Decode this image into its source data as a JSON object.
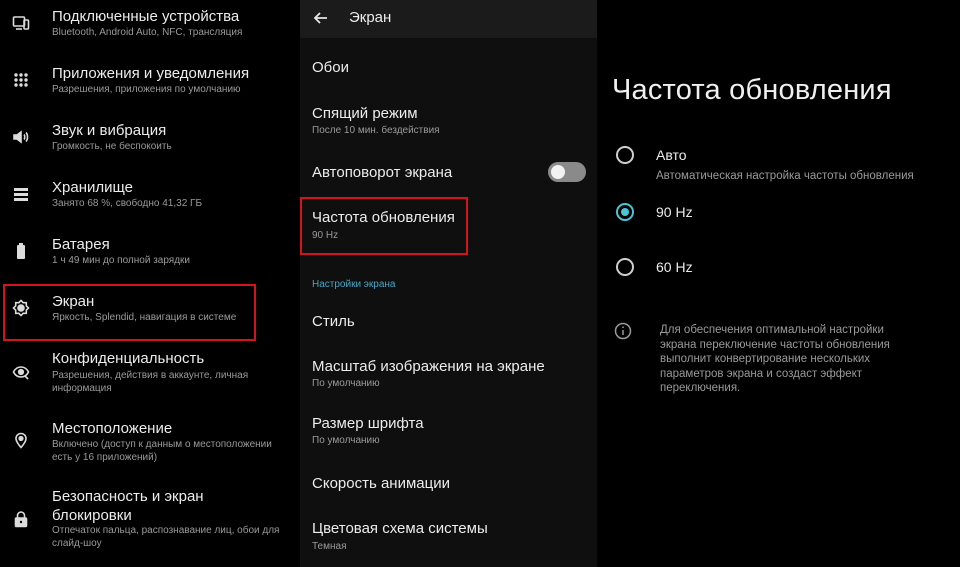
{
  "left_menu": {
    "items": [
      {
        "title": "Подключенные устройства",
        "subtitle": "Bluetooth, Android Auto, NFC, трансляция",
        "icon": "devices-icon"
      },
      {
        "title": "Приложения и уведомления",
        "subtitle": "Разрешения, приложения по умолчанию",
        "icon": "apps-icon"
      },
      {
        "title": "Звук и вибрация",
        "subtitle": "Громкость, не беспокоить",
        "icon": "volume-icon"
      },
      {
        "title": "Хранилище",
        "subtitle": "Занято 68 %, свободно 41,32 ГБ",
        "icon": "storage-icon"
      },
      {
        "title": "Батарея",
        "subtitle": "1 ч 49 мин до полной зарядки",
        "icon": "battery-icon"
      },
      {
        "title": "Экран",
        "subtitle": "Яркость, Splendid, навигация в системе",
        "icon": "display-icon",
        "highlighted": true
      },
      {
        "title": "Конфиденциальность",
        "subtitle": "Разрешения, действия в аккаунте, личная информация",
        "icon": "privacy-eye-icon"
      },
      {
        "title": "Местоположение",
        "subtitle": "Включено (доступ к данным о местоположении есть у 16 приложений)",
        "icon": "location-pin-icon"
      },
      {
        "title": "Безопасность и экран блокировки",
        "subtitle": "Отпечаток пальца, распознавание лиц, обои для слайд-шоу",
        "icon": "lock-icon"
      }
    ]
  },
  "display_screen": {
    "title": "Экран",
    "items": [
      {
        "title": "Обои"
      },
      {
        "title": "Спящий режим",
        "subtitle": "После 10 мин. бездействия"
      },
      {
        "title": "Автоповорот экрана",
        "toggle_on": false
      },
      {
        "title": "Частота обновления",
        "subtitle": "90 Hz",
        "highlighted": true
      },
      {
        "title": "Стиль"
      },
      {
        "title": "Масштаб изображения на экране",
        "subtitle": "По умолчанию"
      },
      {
        "title": "Размер шрифта",
        "subtitle": "По умолчанию"
      },
      {
        "title": "Скорость анимации"
      },
      {
        "title": "Цветовая схема системы",
        "subtitle": "Темная"
      }
    ],
    "section_label": "Настройки экрана"
  },
  "refresh_rate": {
    "title": "Частота обновления",
    "options": [
      {
        "label": "Авто",
        "description": "Автоматическая настройка частоты обновления",
        "selected": false
      },
      {
        "label": "90 Hz",
        "selected": true
      },
      {
        "label": "60 Hz",
        "selected": false
      }
    ],
    "info": "Для обеспечения оптимальной настройки экрана переключение частоты обновления выполнит конвертирование нескольких параметров экрана и создаст эффект переключения."
  },
  "colors": {
    "highlight": "#d4141c",
    "accent": "#49c5d6",
    "section": "#49a6c6"
  }
}
